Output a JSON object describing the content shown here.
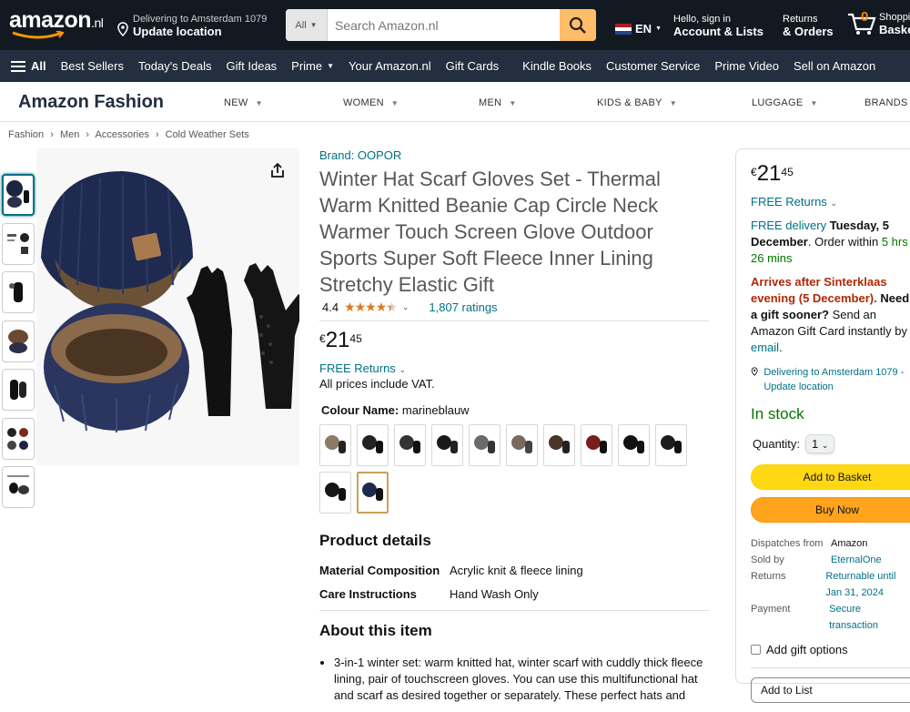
{
  "header": {
    "logo": "amazon",
    "logo_tld": ".nl",
    "deliver_line1": "Delivering to Amsterdam 1079",
    "deliver_line2": "Update location",
    "search_category": "All",
    "search_placeholder": "Search Amazon.nl",
    "lang": "EN",
    "account_line1": "Hello, sign in",
    "account_line2": "Account & Lists",
    "returns_line1": "Returns",
    "returns_line2": "& Orders",
    "cart_count": "0",
    "cart_line1": "Shopping",
    "cart_line2": "Basket"
  },
  "nav": {
    "all": "All",
    "items": [
      "Best Sellers",
      "Today's Deals",
      "Gift Ideas",
      "Prime",
      "Your Amazon.nl",
      "Gift Cards",
      "Kindle Books",
      "Customer Service",
      "Prime Video",
      "Sell on Amazon"
    ]
  },
  "fashion": {
    "title": "Amazon Fashion",
    "categories": [
      "NEW",
      "WOMEN",
      "MEN",
      "KIDS & BABY",
      "LUGGAGE",
      "BRANDS"
    ]
  },
  "breadcrumb": [
    "Fashion",
    "›",
    "Men",
    "›",
    "Accessories",
    "›",
    "Cold Weather Sets"
  ],
  "product": {
    "brand": "Brand: OOPOR",
    "title": "Winter Hat Scarf Gloves Set - Thermal Warm Knitted Beanie Cap Circle Neck Warmer Touch Screen Glove Outdoor Sports Super Soft Fleece Inner Lining Stretchy Elastic Gift",
    "rating": "4.4",
    "rating_stars": 4.4,
    "ratings_count": "1,807 ratings",
    "price_symbol": "€",
    "price_whole": "21",
    "price_fraction": "45",
    "free_returns": "FREE Returns",
    "vat_note": "All prices include VAT.",
    "colour_label": "Colour Name:",
    "colour_value": "marineblauw",
    "details_title": "Product details",
    "details": [
      {
        "key": "Material Composition",
        "value": "Acrylic knit & fleece lining"
      },
      {
        "key": "Care Instructions",
        "value": "Hand Wash Only"
      }
    ],
    "about_title": "About this item",
    "about_first": "3-in-1 winter set: warm knitted hat, winter scarf with cuddly thick fleece lining, pair of touchscreen gloves. You can use this multifunctional hat and scarf as desired together or separately. These perfect hats and"
  },
  "buybox": {
    "price_symbol": "€",
    "price_whole": "21",
    "price_fraction": "45",
    "free_returns": "FREE Returns",
    "free_delivery": "FREE delivery",
    "delivery_date": "Tuesday, 5 December",
    "order_within_pre": ". Order within",
    "order_within_time": "5 hrs 26 mins",
    "arrives": "Arrives after Sinterklaas evening (5 December).",
    "need_gift": "Need a gift sooner?",
    "gift_card_pre": "Send an Amazon Gift Card instantly by",
    "gift_card_link": "email",
    "deliver_to": "Delivering to Amsterdam 1079 - Update location",
    "stock": "In stock",
    "quantity_label": "Quantity:",
    "quantity_value": "1",
    "add_to_basket": "Add to Basket",
    "buy_now": "Buy Now",
    "info": [
      {
        "key": "Dispatches from",
        "value": "Amazon"
      },
      {
        "key": "Sold by",
        "value": "EternalOne"
      },
      {
        "key": "Returns",
        "value": "Returnable until Jan 31, 2024"
      },
      {
        "key": "Payment",
        "value": "Secure transaction"
      }
    ],
    "gift_options": "Add gift options",
    "add_to_list": "Add to List"
  },
  "colors": {
    "header_bg": "#131921",
    "nav_bg": "#232f3e",
    "link": "#007185",
    "basket_btn": "#ffd814",
    "buy_btn": "#ffa41c",
    "search_btn": "#febd69"
  }
}
